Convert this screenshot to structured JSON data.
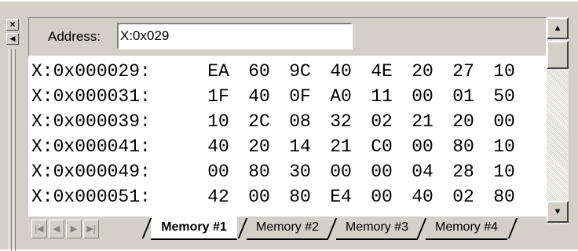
{
  "address": {
    "label": "Address:",
    "value": "X:0x029"
  },
  "memory_rows": [
    {
      "address": "X:0x000029:",
      "bytes": [
        "EA",
        "60",
        "9C",
        "40",
        "4E",
        "20",
        "27",
        "10"
      ]
    },
    {
      "address": "X:0x000031:",
      "bytes": [
        "1F",
        "40",
        "0F",
        "A0",
        "11",
        "00",
        "01",
        "50"
      ]
    },
    {
      "address": "X:0x000039:",
      "bytes": [
        "10",
        "2C",
        "08",
        "32",
        "02",
        "21",
        "20",
        "00"
      ]
    },
    {
      "address": "X:0x000041:",
      "bytes": [
        "40",
        "20",
        "14",
        "21",
        "C0",
        "00",
        "80",
        "10"
      ]
    },
    {
      "address": "X:0x000049:",
      "bytes": [
        "00",
        "80",
        "30",
        "00",
        "00",
        "04",
        "28",
        "10"
      ]
    },
    {
      "address": "X:0x000051:",
      "bytes": [
        "42",
        "00",
        "80",
        "E4",
        "00",
        "40",
        "02",
        "80"
      ]
    }
  ],
  "tabs": [
    {
      "label": "Memory #1",
      "active": true
    },
    {
      "label": "Memory #2",
      "active": false
    },
    {
      "label": "Memory #3",
      "active": false
    },
    {
      "label": "Memory #4",
      "active": false
    }
  ],
  "icons": {
    "close": "close-icon",
    "pin": "arrow-left-icon",
    "scroll_up": "arrow-up-icon",
    "scroll_down": "arrow-down-icon",
    "nav": [
      "first-icon",
      "prev-icon",
      "next-icon",
      "last-icon"
    ]
  }
}
